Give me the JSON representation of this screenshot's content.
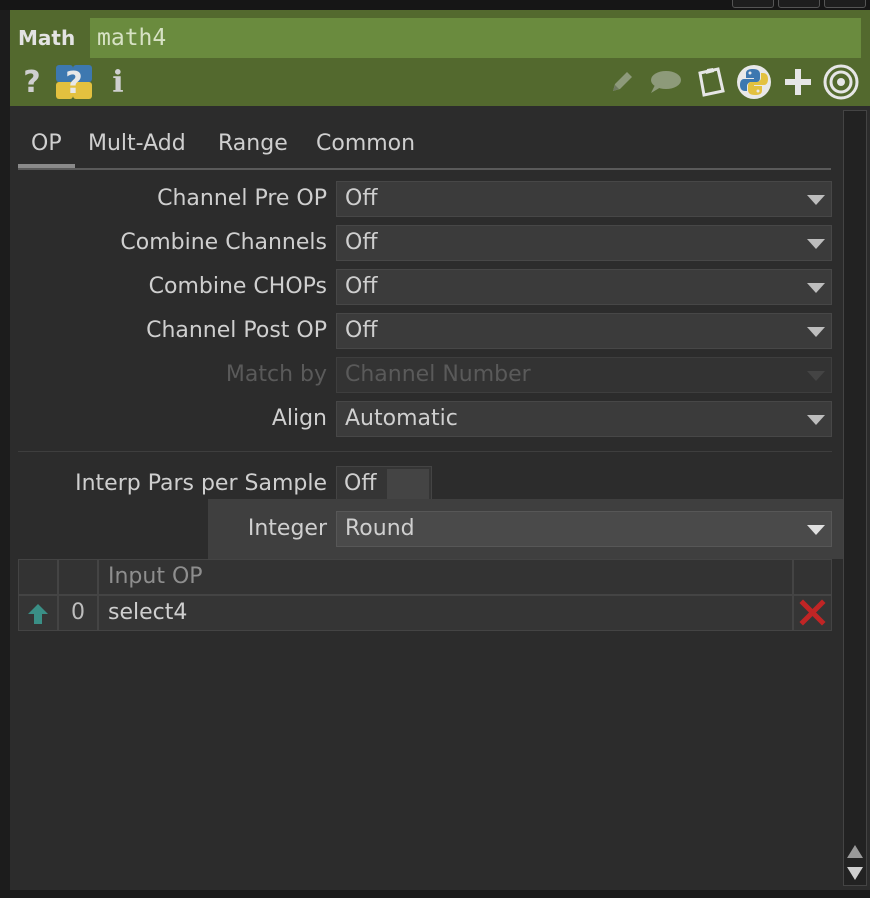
{
  "header": {
    "op_type": "Math",
    "op_name": "math4",
    "left_icons": [
      "help-icon",
      "python-help-icon",
      "info-icon"
    ],
    "right_icons": [
      "edit-icon",
      "comment-icon",
      "clipboard-icon",
      "python-icon",
      "add-icon",
      "viewer-icon"
    ]
  },
  "tabs": [
    "OP",
    "Mult-Add",
    "Range",
    "Common"
  ],
  "active_tab": "OP",
  "params": {
    "channel_pre_op": {
      "label": "Channel Pre OP",
      "value": "Off"
    },
    "combine_channels": {
      "label": "Combine Channels",
      "value": "Off"
    },
    "combine_chops": {
      "label": "Combine CHOPs",
      "value": "Off"
    },
    "channel_post_op": {
      "label": "Channel Post OP",
      "value": "Off"
    },
    "match_by": {
      "label": "Match by",
      "value": "Channel Number"
    },
    "align": {
      "label": "Align",
      "value": "Automatic"
    },
    "interp_pars": {
      "label": "Interp Pars per Sample",
      "value": "Off"
    },
    "integer": {
      "label": "Integer",
      "value": "Round"
    }
  },
  "inputs_table": {
    "header": "Input OP",
    "rows": [
      {
        "index": "0",
        "op": "select4"
      }
    ]
  },
  "colors": {
    "header_bg": "#53692e",
    "name_field_bg": "#6a8b3e",
    "panel_bg": "#2c2c2c",
    "delete_red": "#c02525",
    "arrow_teal": "#3a8f86"
  }
}
